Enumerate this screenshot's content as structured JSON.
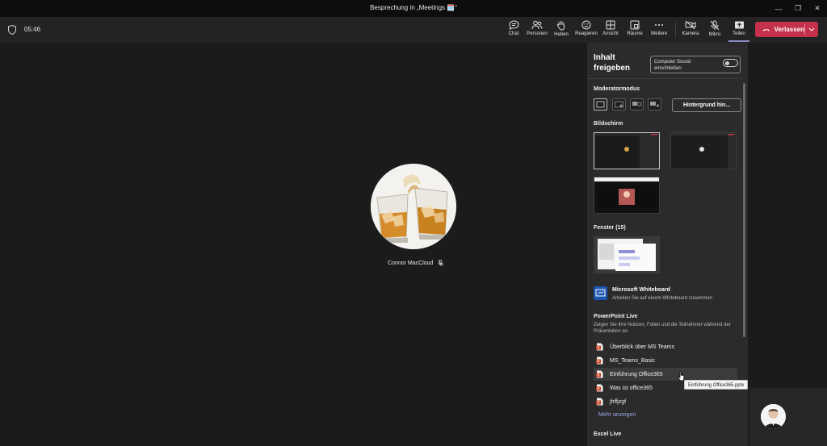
{
  "window": {
    "title": "Besprechung in „Meetings 🗓️“"
  },
  "meeting": {
    "timer": "05:46"
  },
  "toolbar": {
    "buttons": [
      {
        "icon": "chat-icon",
        "label": "Chat"
      },
      {
        "icon": "people-icon",
        "label": "Personen"
      },
      {
        "icon": "raise-hand-icon",
        "label": "Heben"
      },
      {
        "icon": "smiley-icon",
        "label": "Reagieren"
      },
      {
        "icon": "grid-view-icon",
        "label": "Ansicht"
      },
      {
        "icon": "rooms-icon",
        "label": "Räume"
      },
      {
        "icon": "more-icon",
        "label": "Weitere"
      },
      {
        "icon": "camera-off-icon",
        "label": "Kamera"
      },
      {
        "icon": "mic-off-icon",
        "label": "Mikro"
      },
      {
        "icon": "share-tray-icon",
        "label": "Teilen"
      }
    ],
    "leave_label": "Verlassen",
    "accent": "#8b8cc7",
    "leave_color": "#c4314b"
  },
  "stage": {
    "participant_name": "Connor MacCloud"
  },
  "share_panel": {
    "title": "Inhalt freigeben",
    "computer_sound": "Computer Sound einschließen",
    "presenter_mode": {
      "heading": "Moderatormodus",
      "background_button": "Hintergrund hin..."
    },
    "screen": {
      "heading": "Bildschirm"
    },
    "windows": {
      "heading": "Fenster (15)"
    },
    "whiteboard": {
      "title": "Microsoft Whiteboard",
      "subtitle": "Arbeiten Sie auf einem Whiteboard zusammen"
    },
    "powerpoint": {
      "heading": "PowerPoint Live",
      "subtitle": "Zeigen Sie Ihre Notizen, Folien und die Teilnehmer während der Präsentation an.",
      "files": [
        "Überblick über MS Teams",
        "MS_Teams_Basic",
        "Einführung Office365",
        "Was ist office365",
        "jhffjzgf"
      ],
      "more": "Mehr anzeigen"
    },
    "excel": {
      "heading": "Excel Live"
    }
  },
  "tooltip": "Einführung Office365.pptx"
}
